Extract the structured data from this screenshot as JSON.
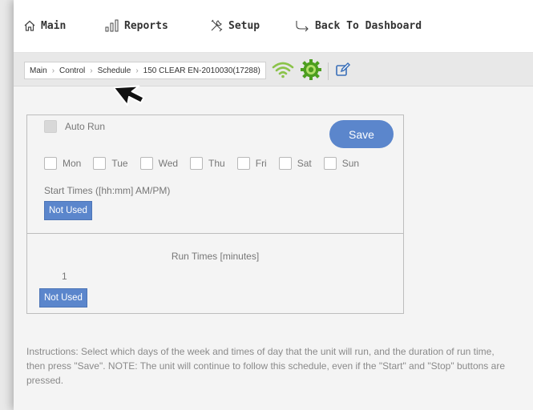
{
  "nav": {
    "main": "Main",
    "reports": "Reports",
    "setup": "Setup",
    "back": "Back To Dashboard"
  },
  "breadcrumb": [
    "Main",
    "Control",
    "Schedule",
    "150 CLEAR EN-2010030(17288)"
  ],
  "status_icons": [
    "wifi-icon",
    "gear-status-icon",
    "edit-icon"
  ],
  "colors": {
    "accent": "#5b86cc",
    "status_green": "#8bc34a",
    "gear_green": "#4c9e1f"
  },
  "schedule": {
    "auto_run_label": "Auto Run",
    "auto_run_checked": false,
    "save_label": "Save",
    "days": [
      "Mon",
      "Tue",
      "Wed",
      "Thu",
      "Fri",
      "Sat",
      "Sun"
    ],
    "start_times_label": "Start Times ([hh:mm] AM/PM)",
    "start_time_value": "Not Used",
    "run_times_label": "Run Times [minutes]",
    "run_index": "1",
    "run_time_value": "Not Used"
  },
  "instructions": "Instructions: Select which days of the week and times of day that the unit will run, and the duration of run time, then press \"Save\". NOTE: The unit will continue to follow this schedule, even if the \"Start\" and \"Stop\" buttons are pressed."
}
